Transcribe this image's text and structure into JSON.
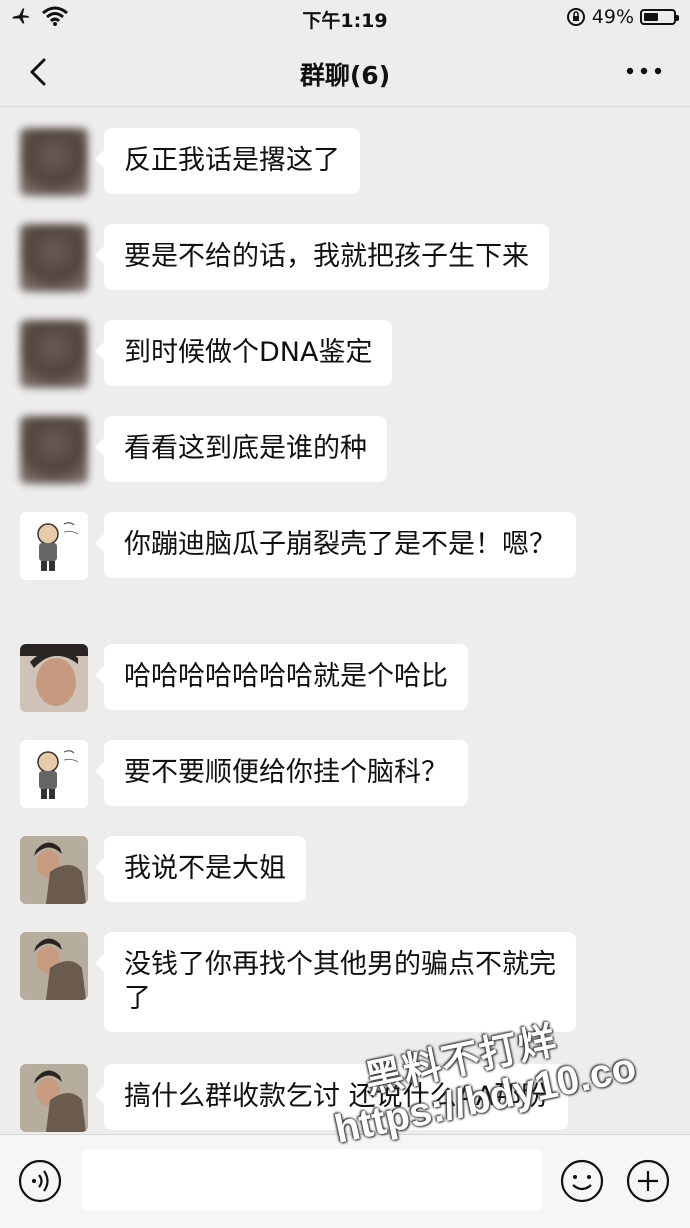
{
  "status_bar": {
    "time": "下午1:19",
    "battery": "49%",
    "battery_level": 0.49
  },
  "header": {
    "title": "群聊(6)"
  },
  "messages": [
    {
      "text": "反正我话是撂这了",
      "avatar": "blurred-avatar"
    },
    {
      "text": "要是不给的话，我就把孩子生下来",
      "avatar": "blurred-avatar"
    },
    {
      "text": "到时候做个DNA鉴定",
      "avatar": "blurred-avatar"
    },
    {
      "text": "看看这到底是谁的种",
      "avatar": "blurred-avatar"
    },
    {
      "text": "你蹦迪脑瓜子崩裂壳了是不是！嗯？",
      "avatar": "cartoon-avatar"
    },
    {
      "text": "哈哈哈哈哈哈哈就是个哈比",
      "avatar": "man-avatar"
    },
    {
      "text": "要不要顺便给你挂个脑科？",
      "avatar": "cartoon-avatar"
    },
    {
      "text": "我说不是大姐",
      "avatar": "man-dog-avatar"
    },
    {
      "text": "没钱了你再找个其他男的骗点不就完了",
      "avatar": "man-dog-avatar"
    },
    {
      "text": "搞什么群收款乞讨 还说什么AA那盼",
      "avatar": "man-dog-avatar"
    }
  ],
  "watermark": {
    "line1": "黑料不打烊",
    "line2": "https://bdy10.co"
  },
  "icons": {
    "back": "chevron-left-icon",
    "more": "more-icon",
    "voice": "voice-icon",
    "emoji": "emoji-icon",
    "plus": "plus-icon",
    "airplane": "airplane-icon",
    "wifi": "wifi-icon",
    "lock": "orientation-lock-icon",
    "battery": "battery-icon"
  }
}
